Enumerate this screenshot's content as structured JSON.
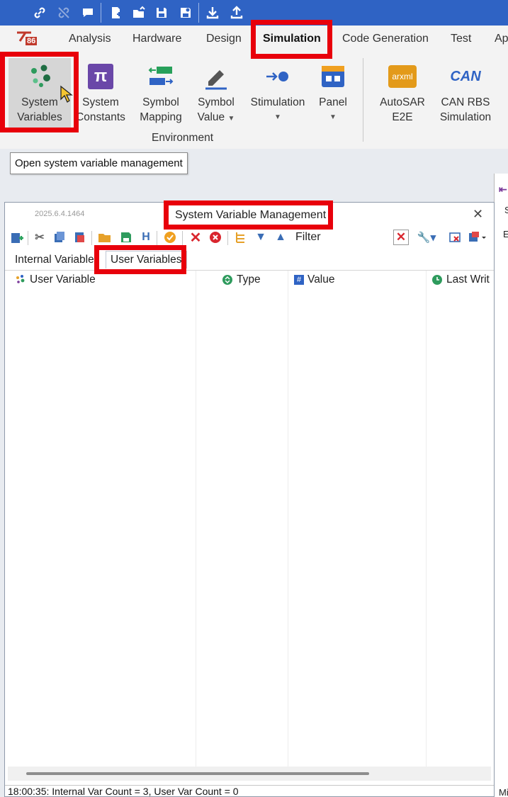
{
  "ribbon_tabs": [
    "Analysis",
    "Hardware",
    "Design",
    "Simulation",
    "Code Generation",
    "Test",
    "Ap"
  ],
  "active_tab": "Simulation",
  "logo_text": "86",
  "ribbon_buttons": {
    "system_variables": [
      "System",
      "Variables"
    ],
    "system_constants": [
      "System",
      "Constants"
    ],
    "symbol_mapping": [
      "Symbol",
      "Mapping"
    ],
    "symbol_value": [
      "Symbol",
      "Value"
    ],
    "stimulation": [
      "Stimulation"
    ],
    "panel": [
      "Panel"
    ],
    "autosar_e2e": [
      "AutoSAR",
      "E2E"
    ],
    "can_rbs": [
      "CAN RBS",
      "Simulation"
    ]
  },
  "autosar_icon_text": "arxml",
  "can_icon_text": "CAN",
  "const_icon_text": "π",
  "group_label": "Environment",
  "tooltip": "Open system variable management",
  "dialog": {
    "version": "2025.6.4.1464",
    "title": "System Variable Management",
    "close": "✕",
    "filter_label": "Filter",
    "tabs": [
      "Internal Variable",
      "User Variables"
    ],
    "active_subtab": "User Variables",
    "columns": [
      "User Variable",
      "Type",
      "Value",
      "Last Writ"
    ],
    "status": "18:00:35: Internal Var Count = 3, User Var Count = 0"
  },
  "colors": {
    "qat": "#2f63c4",
    "highlight": "#e8000b",
    "ribbon": "#f3f3f3"
  },
  "rightpanel_labels": [
    "S",
    "E",
    "Mi"
  ]
}
